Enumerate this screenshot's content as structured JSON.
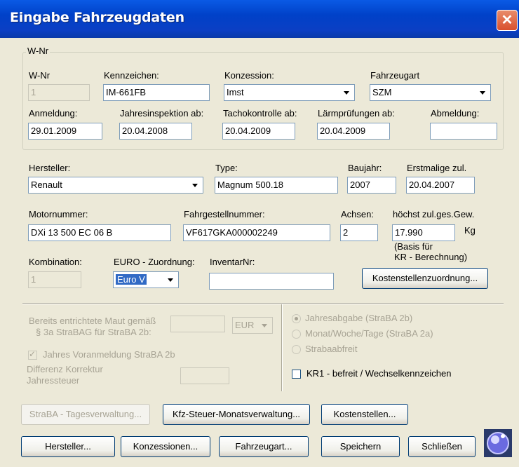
{
  "window": {
    "title": "Eingabe Fahrzeugdaten"
  },
  "wnr_group": {
    "title": "W-Nr",
    "wnr_label": "W-Nr",
    "wnr_value": "1",
    "kennzeichen_label": "Kennzeichen:",
    "kennzeichen_value": "IM-661FB",
    "konzession_label": "Konzession:",
    "konzession_value": "Imst",
    "fahrzeugart_label": "Fahrzeugart",
    "fahrzeugart_value": "SZM",
    "anmeldung_label": "Anmeldung:",
    "anmeldung_value": "29.01.2009",
    "jahresinspektion_label": "Jahresinspektion ab:",
    "jahresinspektion_value": "20.04.2008",
    "tachokontrolle_label": "Tachokontrolle ab:",
    "tachokontrolle_value": "20.04.2009",
    "laerm_label": "Lärmprüfungen ab:",
    "laerm_value": "20.04.2009",
    "abmeldung_label": "Abmeldung:",
    "abmeldung_value": ""
  },
  "vehicle": {
    "hersteller_label": "Hersteller:",
    "hersteller_value": "Renault",
    "type_label": "Type:",
    "type_value": "Magnum 500.18",
    "baujahr_label": "Baujahr:",
    "baujahr_value": "2007",
    "erstmalige_label": "Erstmalige zul.",
    "erstmalige_value": "20.04.2007",
    "motornummer_label": "Motornummer:",
    "motornummer_value": "DXi 13 500 EC 06 B",
    "fahrgestell_label": "Fahrgestellnummer:",
    "fahrgestell_value": "VF617GKA000002249",
    "achsen_label": "Achsen:",
    "achsen_value": "2",
    "gewicht_label": "höchst zul.ges.Gew.",
    "gewicht_value": "17.990",
    "gewicht_unit": "Kg",
    "gewicht_note1": "(Basis für",
    "gewicht_note2": "KR - Berechnung)",
    "kombination_label": "Kombination:",
    "kombination_value": "1",
    "euro_label": "EURO - Zuordnung:",
    "euro_value": "Euro V",
    "inventar_label": "InventarNr:",
    "inventar_value": "",
    "kostenstellen_btn": "Kostenstellenzuordnung..."
  },
  "maut": {
    "line1": "Bereits entrichtete Maut gemäß",
    "line2": "§ 3a StraBAG für StraBA 2b:",
    "currency": "EUR",
    "voranmeldung_label": "Jahres Voranmeldung StraBA 2b",
    "diff_line1": "Differenz Korrektur",
    "diff_line2": "Jahressteuer",
    "radio1": "Jahresabgabe (StraBA 2b)",
    "radio2": "Monat/Woche/Tage (StraBA 2a)",
    "radio3": "Strabaabfreit",
    "kr1_label": "KR1 - befreit / Wechselkennzeichen"
  },
  "buttons_row1": {
    "straba": "StraBA - Tagesverwaltung...",
    "kfz": "Kfz-Steuer-Monatsverwaltung...",
    "kostenstellen": "Kostenstellen..."
  },
  "buttons_row2": {
    "hersteller": "Hersteller...",
    "konzessionen": "Konzessionen...",
    "fahrzeugart": "Fahrzeugart...",
    "speichern": "Speichern",
    "schliessen": "Schließen"
  },
  "colors": {
    "titlebar": "#0a5ae5",
    "dialog_bg": "#ece9d8",
    "close_button": "#d9502e",
    "selection": "#316ac5"
  },
  "icons": {
    "close": "close-icon",
    "app_logo": "globe-logo-icon"
  }
}
